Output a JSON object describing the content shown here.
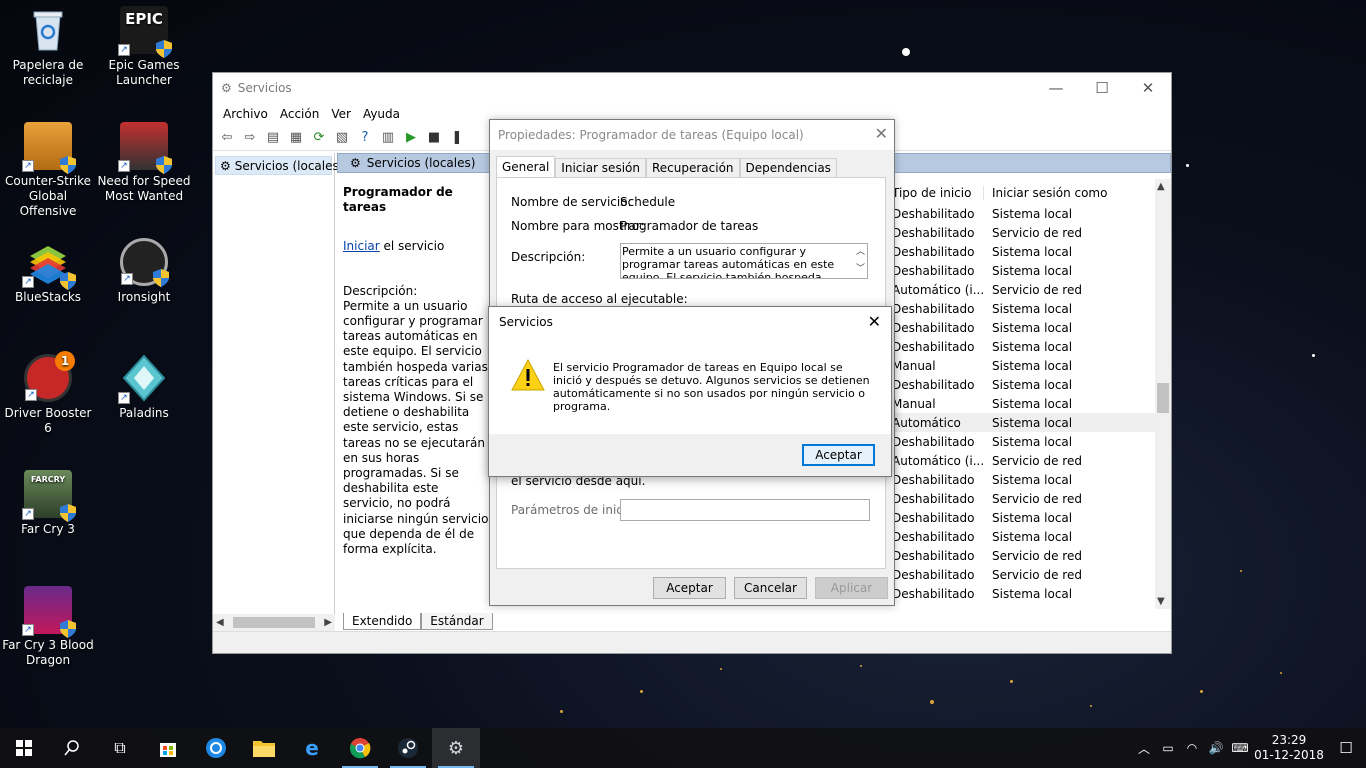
{
  "desktop": {
    "icons": [
      {
        "label": "Papelera de reciclaje"
      },
      {
        "label": "Epic Games Launcher",
        "logo_text": "EPIC"
      },
      {
        "label": "Counter-Strike Global Offensive"
      },
      {
        "label": "Need for Speed Most Wanted"
      },
      {
        "label": "BlueStacks"
      },
      {
        "label": "Ironsight"
      },
      {
        "label": "Driver Booster 6",
        "badge": "1"
      },
      {
        "label": "Paladins"
      },
      {
        "label": "Far Cry 3",
        "logo_text": "FARCRY"
      },
      {
        "label": "Far Cry 3 Blood Dragon"
      }
    ]
  },
  "window": {
    "title": "Servicios",
    "menu": [
      "Archivo",
      "Acción",
      "Ver",
      "Ayuda"
    ],
    "tree_item": "Servicios (locales)",
    "band_title": "Servicios (locales)",
    "detail": {
      "heading": "Programador de tareas",
      "start_link": "Iniciar",
      "start_suffix": " el servicio",
      "desc_label": "Descripción:",
      "desc_text": "Permite a un usuario configurar y programar tareas automáticas en este equipo. El servicio también hospeda varias tareas críticas para el sistema Windows. Si se detiene o deshabilita este servicio, estas tareas no se ejecutarán en sus horas programadas. Si se deshabilita este servicio, no podrá iniciarse ningún servicio que dependa de él de forma explícita."
    },
    "columns": {
      "startup_type": "Tipo de inicio",
      "logon_as": "Iniciar sesión como"
    },
    "rows": [
      {
        "startup": "Deshabilitado",
        "logon": "Sistema local"
      },
      {
        "startup": "Deshabilitado",
        "logon": "Servicio de red"
      },
      {
        "startup": "Deshabilitado",
        "logon": "Sistema local"
      },
      {
        "startup": "Deshabilitado",
        "logon": "Sistema local"
      },
      {
        "startup": "Automático (i...",
        "logon": "Servicio de red"
      },
      {
        "startup": "Deshabilitado",
        "logon": "Sistema local"
      },
      {
        "startup": "Deshabilitado",
        "logon": "Sistema local"
      },
      {
        "startup": "Deshabilitado",
        "logon": "Sistema local"
      },
      {
        "startup": "Manual",
        "logon": "Sistema local"
      },
      {
        "startup": "Deshabilitado",
        "logon": "Sistema local"
      },
      {
        "startup": "Manual",
        "logon": "Sistema local"
      },
      {
        "startup": "Automático",
        "logon": "Sistema local"
      },
      {
        "startup": "Deshabilitado",
        "logon": "Sistema local"
      },
      {
        "startup": "Automático (i...",
        "logon": "Servicio de red"
      },
      {
        "startup": "Deshabilitado",
        "logon": "Sistema local"
      },
      {
        "startup": "Deshabilitado",
        "logon": "Servicio de red"
      },
      {
        "startup": "Deshabilitado",
        "logon": "Sistema local"
      },
      {
        "startup": "Deshabilitado",
        "logon": "Sistema local"
      },
      {
        "startup": "Deshabilitado",
        "logon": "Servicio de red"
      },
      {
        "startup": "Deshabilitado",
        "logon": "Servicio de red"
      },
      {
        "startup": "Deshabilitado",
        "logon": "Sistema local"
      }
    ],
    "bottom_tabs": [
      "Extendido",
      "Estándar"
    ]
  },
  "properties": {
    "title": "Propiedades: Programador de tareas (Equipo local)",
    "tabs": [
      "General",
      "Iniciar sesión",
      "Recuperación",
      "Dependencias"
    ],
    "service_name_label": "Nombre de servicio:",
    "service_name": "Schedule",
    "display_name_label": "Nombre para mostrar:",
    "display_name": "Programador de tareas",
    "description_label": "Descripción:",
    "description": "Permite a un usuario configurar y programar tareas automáticas en este equipo. El servicio también hospeda varias tareas críticas para el",
    "path_label": "Ruta de acceso al ejecutable:",
    "hint": "el servicio desde aquí.",
    "params_label": "Parámetros de inicio:",
    "params_value": "",
    "ok": "Aceptar",
    "cancel": "Cancelar",
    "apply": "Aplicar"
  },
  "message": {
    "title": "Servicios",
    "text": "El servicio Programador de tareas en Equipo local se inició y después se detuvo. Algunos servicios se detienen automáticamente si no son usados por ningún servicio o programa.",
    "ok": "Aceptar"
  },
  "taskbar": {
    "time": "23:29",
    "date": "01-12-2018"
  },
  "colors": {
    "accent": "#0078d7",
    "band": "#b6c9e0",
    "link": "#0645ad"
  }
}
